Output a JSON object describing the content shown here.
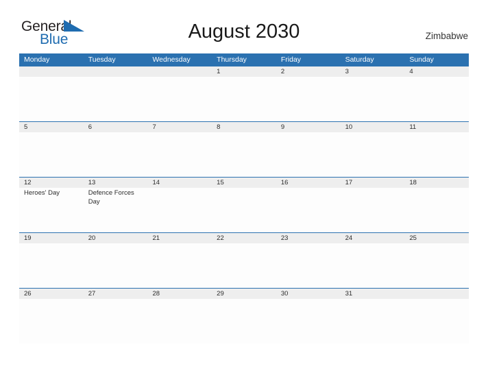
{
  "logo": {
    "word1": "General",
    "word2": "Blue",
    "flag_icon": "triangle-flag-icon",
    "color_dark": "#231f20",
    "color_blue": "#1f6cb0"
  },
  "header": {
    "title": "August 2030",
    "country": "Zimbabwe"
  },
  "theme": {
    "header_blue": "#2b71b0",
    "daynum_band": "#eeeeee",
    "cell_background": "#fdfdfd",
    "text": "#2b2b2b"
  },
  "calendar": {
    "weekdays": [
      "Monday",
      "Tuesday",
      "Wednesday",
      "Thursday",
      "Friday",
      "Saturday",
      "Sunday"
    ],
    "weeks": [
      [
        {
          "day": "",
          "event": ""
        },
        {
          "day": "",
          "event": ""
        },
        {
          "day": "",
          "event": ""
        },
        {
          "day": "1",
          "event": ""
        },
        {
          "day": "2",
          "event": ""
        },
        {
          "day": "3",
          "event": ""
        },
        {
          "day": "4",
          "event": ""
        }
      ],
      [
        {
          "day": "5",
          "event": ""
        },
        {
          "day": "6",
          "event": ""
        },
        {
          "day": "7",
          "event": ""
        },
        {
          "day": "8",
          "event": ""
        },
        {
          "day": "9",
          "event": ""
        },
        {
          "day": "10",
          "event": ""
        },
        {
          "day": "11",
          "event": ""
        }
      ],
      [
        {
          "day": "12",
          "event": "Heroes' Day"
        },
        {
          "day": "13",
          "event": "Defence Forces Day"
        },
        {
          "day": "14",
          "event": ""
        },
        {
          "day": "15",
          "event": ""
        },
        {
          "day": "16",
          "event": ""
        },
        {
          "day": "17",
          "event": ""
        },
        {
          "day": "18",
          "event": ""
        }
      ],
      [
        {
          "day": "19",
          "event": ""
        },
        {
          "day": "20",
          "event": ""
        },
        {
          "day": "21",
          "event": ""
        },
        {
          "day": "22",
          "event": ""
        },
        {
          "day": "23",
          "event": ""
        },
        {
          "day": "24",
          "event": ""
        },
        {
          "day": "25",
          "event": ""
        }
      ],
      [
        {
          "day": "26",
          "event": ""
        },
        {
          "day": "27",
          "event": ""
        },
        {
          "day": "28",
          "event": ""
        },
        {
          "day": "29",
          "event": ""
        },
        {
          "day": "30",
          "event": ""
        },
        {
          "day": "31",
          "event": ""
        },
        {
          "day": "",
          "event": ""
        }
      ]
    ]
  }
}
